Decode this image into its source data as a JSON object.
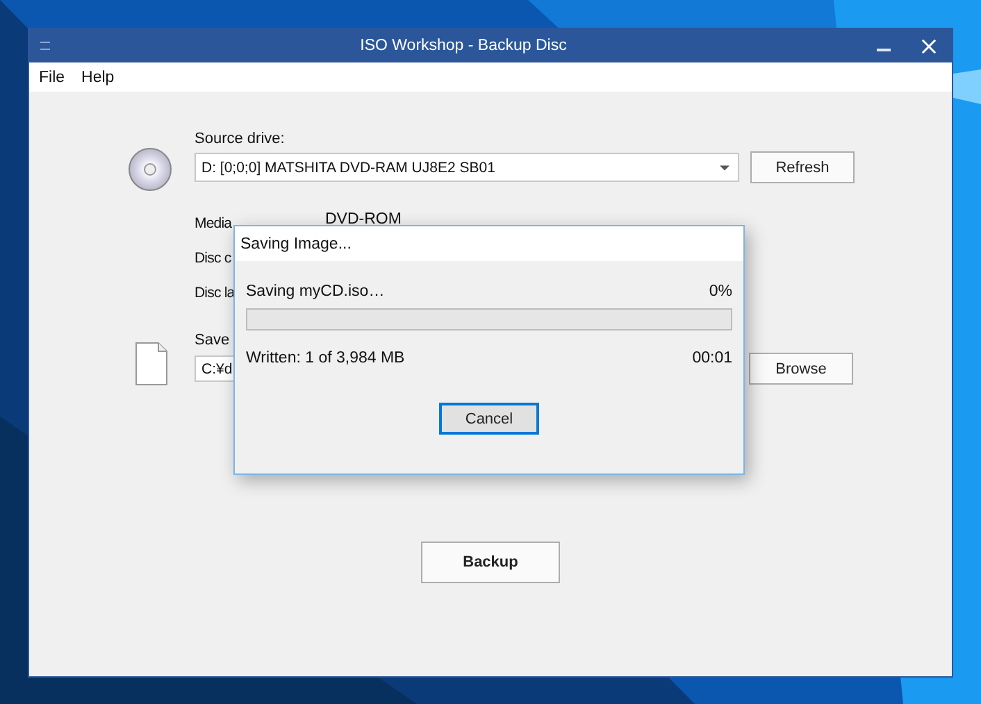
{
  "window": {
    "title": "ISO Workshop - Backup Disc"
  },
  "menu": [
    "File",
    "Help"
  ],
  "source": {
    "label": "Source drive:",
    "value": "D:  [0;0;0] MATSHITA DVD-RAM UJ8E2 SB01",
    "button": "Refresh"
  },
  "info": [
    {
      "label": "Media",
      "value": "DVD-ROM"
    },
    {
      "label": "Disc c"
    },
    {
      "label": "Disc la"
    }
  ],
  "save": {
    "label": "Save",
    "value": "C:¥d",
    "button": "Browse"
  },
  "action": "Backup",
  "dialog": {
    "title": "Saving Image...",
    "status": "Saving myCD.iso…",
    "percent": "0%",
    "level": 0,
    "written": "Written: 1 of 3,984 MB",
    "time": "00:01",
    "button": "Cancel",
    "button_focused": true
  }
}
